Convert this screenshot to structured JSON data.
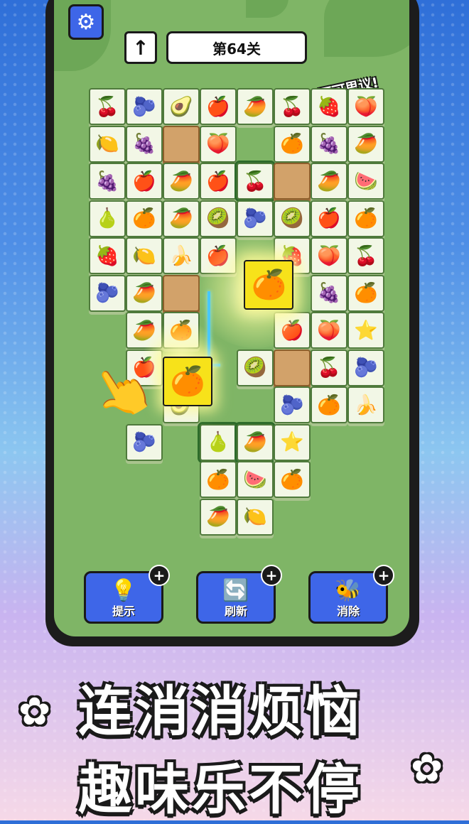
{
  "header": {
    "settings_icon": "gear-icon",
    "up_icon": "arrow-up-icon",
    "level_label": "第64关"
  },
  "praise_text": "不可思议!",
  "tiles": [
    {
      "r": 0,
      "c": 0,
      "f": "🍒"
    },
    {
      "r": 0,
      "c": 1,
      "f": "🫐"
    },
    {
      "r": 0,
      "c": 2,
      "f": "🥑"
    },
    {
      "r": 0,
      "c": 3,
      "f": "🍎"
    },
    {
      "r": 0,
      "c": 4,
      "f": "🥭"
    },
    {
      "r": 0,
      "c": 5,
      "f": "🍒"
    },
    {
      "r": 0,
      "c": 6,
      "f": "🍓"
    },
    {
      "r": 0,
      "c": 7,
      "f": "🍑"
    },
    {
      "r": 1,
      "c": 0,
      "f": "🍋"
    },
    {
      "r": 1,
      "c": 1,
      "f": "🍇"
    },
    {
      "r": 1,
      "c": 2,
      "f": "",
      "t": "wood"
    },
    {
      "r": 1,
      "c": 3,
      "f": "🍑"
    },
    {
      "r": 1,
      "c": 5,
      "f": "🍊"
    },
    {
      "r": 1,
      "c": 6,
      "f": "🍇"
    },
    {
      "r": 1,
      "c": 7,
      "f": "🥭"
    },
    {
      "r": 2,
      "c": 0,
      "f": "🍇"
    },
    {
      "r": 2,
      "c": 1,
      "f": "🍎"
    },
    {
      "r": 2,
      "c": 2,
      "f": "🥭"
    },
    {
      "r": 2,
      "c": 3,
      "f": "🍎"
    },
    {
      "r": 2,
      "c": 4,
      "f": "🍒",
      "t": "vine"
    },
    {
      "r": 2,
      "c": 5,
      "f": "",
      "t": "wood"
    },
    {
      "r": 2,
      "c": 6,
      "f": "🥭"
    },
    {
      "r": 2,
      "c": 7,
      "f": "🍉"
    },
    {
      "r": 3,
      "c": 0,
      "f": "🍐"
    },
    {
      "r": 3,
      "c": 1,
      "f": "🍊"
    },
    {
      "r": 3,
      "c": 2,
      "f": "🥭"
    },
    {
      "r": 3,
      "c": 3,
      "f": "🥝"
    },
    {
      "r": 3,
      "c": 4,
      "f": "🫐"
    },
    {
      "r": 3,
      "c": 5,
      "f": "🥝"
    },
    {
      "r": 3,
      "c": 6,
      "f": "🍎"
    },
    {
      "r": 3,
      "c": 7,
      "f": "🍊"
    },
    {
      "r": 4,
      "c": 0,
      "f": "🍓"
    },
    {
      "r": 4,
      "c": 1,
      "f": "🍋"
    },
    {
      "r": 4,
      "c": 2,
      "f": "🍌"
    },
    {
      "r": 4,
      "c": 3,
      "f": "🍎"
    },
    {
      "r": 4,
      "c": 5,
      "f": "🍓"
    },
    {
      "r": 4,
      "c": 6,
      "f": "🍑"
    },
    {
      "r": 4,
      "c": 7,
      "f": "🍒"
    },
    {
      "r": 5,
      "c": 0,
      "f": "🫐"
    },
    {
      "r": 5,
      "c": 1,
      "f": "🥭"
    },
    {
      "r": 5,
      "c": 2,
      "f": "",
      "t": "wood"
    },
    {
      "r": 5,
      "c": 6,
      "f": "🍇"
    },
    {
      "r": 5,
      "c": 7,
      "f": "🍊"
    },
    {
      "r": 6,
      "c": 1,
      "f": "🥭"
    },
    {
      "r": 6,
      "c": 2,
      "f": "🍊"
    },
    {
      "r": 6,
      "c": 5,
      "f": "🍎"
    },
    {
      "r": 6,
      "c": 6,
      "f": "🍑"
    },
    {
      "r": 6,
      "c": 7,
      "f": "⭐"
    },
    {
      "r": 7,
      "c": 1,
      "f": "🍎"
    },
    {
      "r": 7,
      "c": 4,
      "f": "🥝"
    },
    {
      "r": 7,
      "c": 5,
      "f": "",
      "t": "wood"
    },
    {
      "r": 7,
      "c": 6,
      "f": "🍒"
    },
    {
      "r": 7,
      "c": 7,
      "f": "🫐"
    },
    {
      "r": 8,
      "c": 2,
      "f": "🥑"
    },
    {
      "r": 8,
      "c": 5,
      "f": "🫐"
    },
    {
      "r": 8,
      "c": 6,
      "f": "🍊"
    },
    {
      "r": 8,
      "c": 7,
      "f": "🍌"
    },
    {
      "r": 9,
      "c": 1,
      "f": "🫐"
    },
    {
      "r": 9,
      "c": 3,
      "f": "🍐",
      "t": "vine"
    },
    {
      "r": 9,
      "c": 4,
      "f": "🥭",
      "t": "vine"
    },
    {
      "r": 9,
      "c": 5,
      "f": "⭐"
    },
    {
      "r": 10,
      "c": 3,
      "f": "🍊"
    },
    {
      "r": 10,
      "c": 4,
      "f": "🍉"
    },
    {
      "r": 10,
      "c": 5,
      "f": "🍊"
    },
    {
      "r": 11,
      "c": 3,
      "f": "🥭"
    },
    {
      "r": 11,
      "c": 4,
      "f": "🍋"
    }
  ],
  "selected": [
    {
      "r": 4.6,
      "c": 4.2,
      "f": "🍊"
    },
    {
      "r": 7.2,
      "c": 2.0,
      "f": "🍊"
    }
  ],
  "tools": [
    {
      "label": "提示",
      "icon": "lightbulb-icon",
      "glyph": "💡"
    },
    {
      "label": "刷新",
      "icon": "refresh-icon",
      "glyph": "🔄"
    },
    {
      "label": "消除",
      "icon": "bee-icon",
      "glyph": "🐝"
    }
  ],
  "slogan": {
    "line1": "连消消烦恼",
    "line2": "趣味乐不停"
  }
}
